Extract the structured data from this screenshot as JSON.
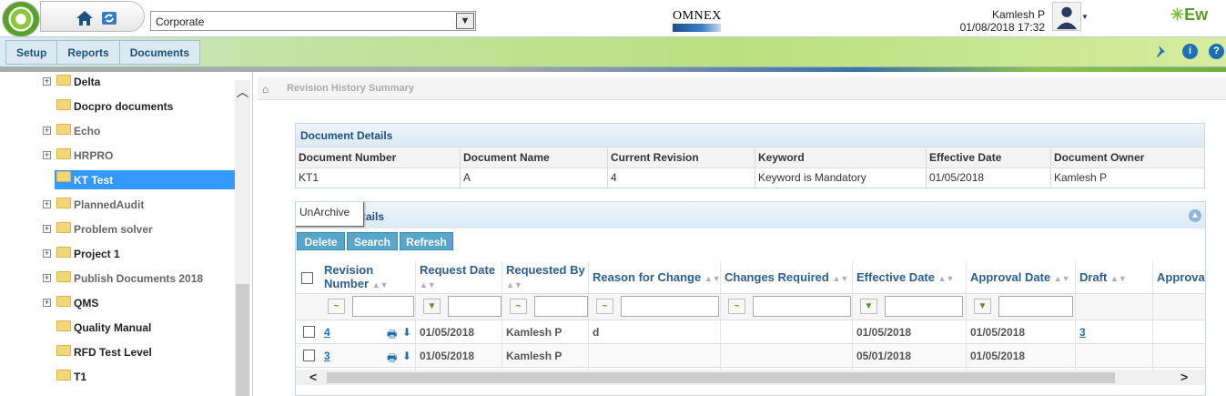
{
  "header": {
    "site_select": "Corporate",
    "brand_logo": "OMNEX",
    "user_name": "Kamlesh P",
    "datetime": "01/08/2018 17:32",
    "app_brand": "Ew",
    "icons": [
      "home-icon",
      "refresh-icon",
      "dropdown-icon",
      "avatar-icon",
      "pin-icon",
      "info-icon",
      "help-icon"
    ]
  },
  "menu": {
    "items": [
      "Setup",
      "Reports",
      "Documents"
    ]
  },
  "sidebar": {
    "items": [
      {
        "label": "Delta",
        "expandable": true
      },
      {
        "label": "Docpro documents",
        "expandable": false
      },
      {
        "label": "Echo",
        "expandable": true,
        "muted": true
      },
      {
        "label": "HRPRO",
        "expandable": true,
        "muted": true
      },
      {
        "label": "KT Test",
        "expandable": false,
        "selected": true
      },
      {
        "label": "PlannedAudit",
        "expandable": true,
        "muted": true
      },
      {
        "label": "Problem solver",
        "expandable": true,
        "muted": true
      },
      {
        "label": "Project 1",
        "expandable": true
      },
      {
        "label": "Publish Documents 2018",
        "expandable": true,
        "muted": true
      },
      {
        "label": "QMS",
        "expandable": true
      },
      {
        "label": "Quality Manual",
        "expandable": false
      },
      {
        "label": "RFD Test Level",
        "expandable": false
      },
      {
        "label": "T1",
        "expandable": false
      }
    ]
  },
  "breadcrumb": {
    "current": "Revision History Summary"
  },
  "document_details": {
    "title": "Document Details",
    "columns": [
      "Document Number",
      "Document Name",
      "Current Revision",
      "Keyword",
      "Effective Date",
      "Document Owner"
    ],
    "row": [
      "KT1",
      "A",
      "4",
      "Keyword is Mandatory",
      "01/05/2018",
      "Kamlesh P"
    ]
  },
  "revision_details": {
    "title_visible": "tails",
    "tooltip": "UnArchive",
    "buttons": [
      "Delete",
      "Search",
      "Refresh"
    ],
    "columns": [
      "Revision Number",
      "Request Date",
      "Requested By",
      "Reason for Change",
      "Changes Required",
      "Effective Date",
      "Approval Date",
      "Draft",
      "Approva"
    ],
    "rows": [
      {
        "revision": "4",
        "request_date": "01/05/2018",
        "requested_by": "Kamlesh P",
        "reason": "d",
        "changes": "",
        "effective": "01/05/2018",
        "approval": "01/05/2018",
        "draft": "3"
      },
      {
        "revision": "3",
        "request_date": "01/05/2018",
        "requested_by": "Kamlesh P",
        "reason": "",
        "changes": "",
        "effective": "05/01/2018",
        "approval": "01/05/2018",
        "draft": ""
      }
    ]
  }
}
